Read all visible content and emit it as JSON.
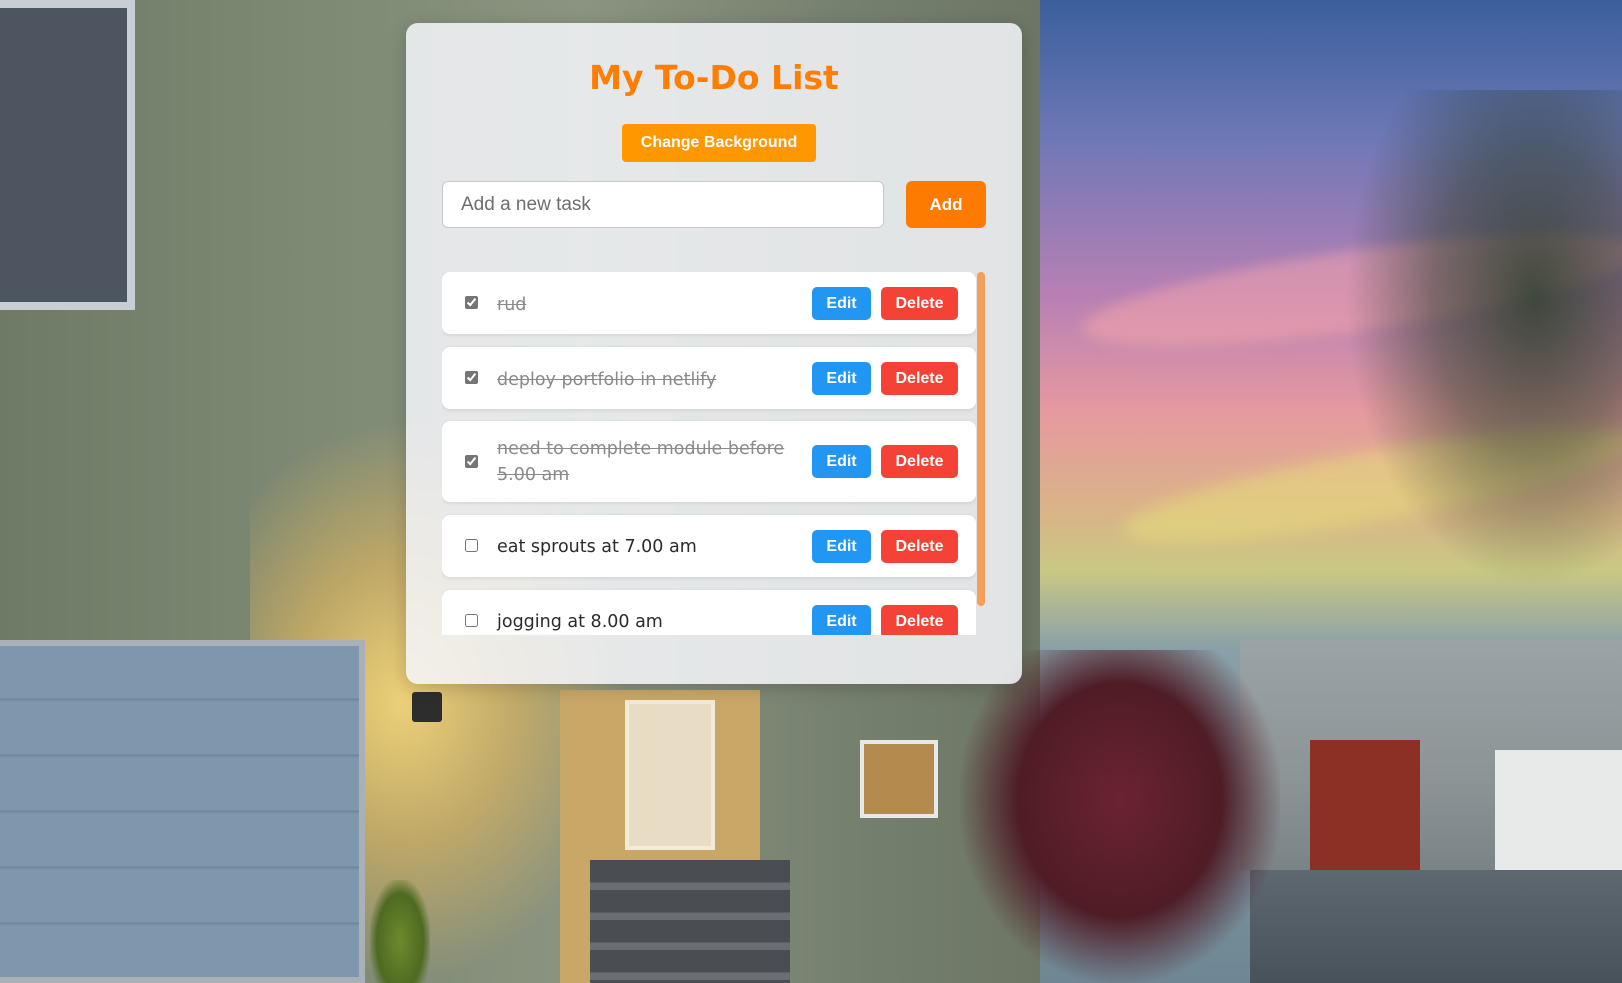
{
  "app": {
    "title": "My To-Do List",
    "change_background_label": "Change Background"
  },
  "new_task": {
    "placeholder": "Add a new task",
    "value": "",
    "add_label": "Add"
  },
  "tasks": [
    {
      "text": "rud",
      "completed": true,
      "edit_label": "Edit",
      "delete_label": "Delete"
    },
    {
      "text": "deploy portfolio in netlify",
      "completed": true,
      "edit_label": "Edit",
      "delete_label": "Delete"
    },
    {
      "text": "need to complete module before 5.00 am",
      "completed": true,
      "edit_label": "Edit",
      "delete_label": "Delete"
    },
    {
      "text": "eat sprouts at 7.00 am",
      "completed": false,
      "edit_label": "Edit",
      "delete_label": "Delete"
    },
    {
      "text": "jogging at 8.00 am",
      "completed": false,
      "edit_label": "Edit",
      "delete_label": "Delete"
    }
  ],
  "colors": {
    "accent": "#ff7d00",
    "change_background_button": "#ff9800",
    "add_button": "#ff7a00",
    "edit_button": "#2196f3",
    "delete_button": "#f44336",
    "scrollbar": "#f5a05a"
  }
}
